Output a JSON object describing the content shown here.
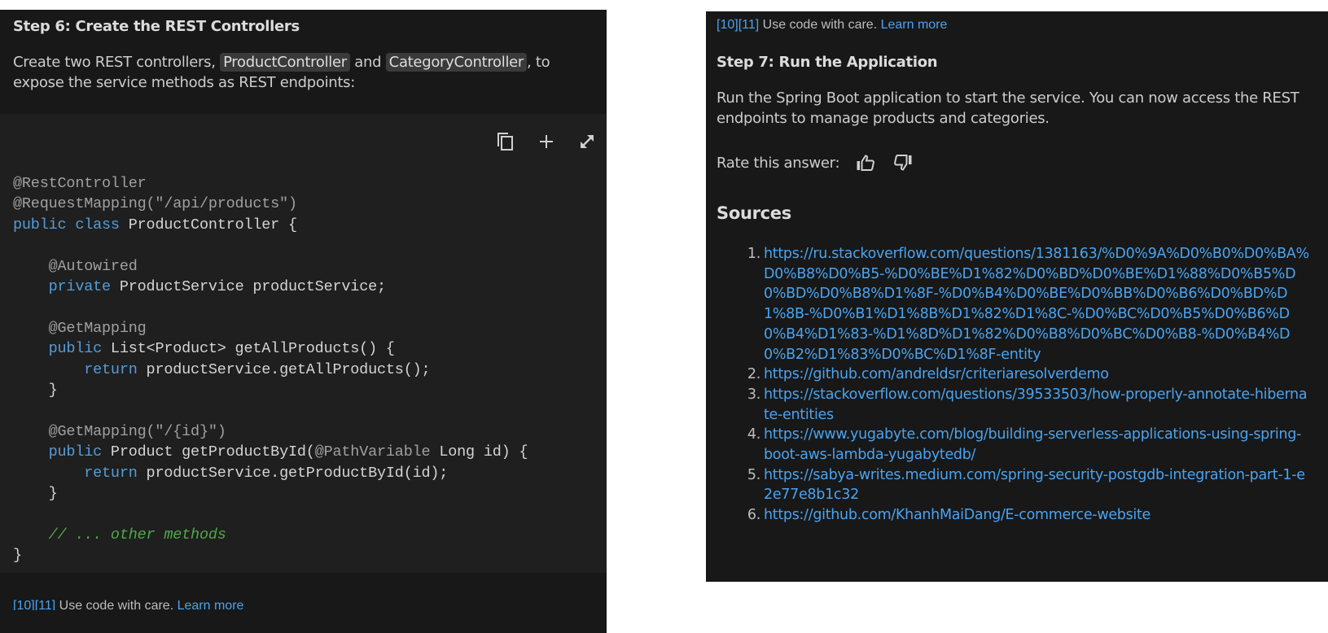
{
  "left": {
    "step_title": "Step 6: Create the REST Controllers",
    "intro": {
      "before": "Create two REST controllers, ",
      "chip1": "ProductController",
      "middle": " and ",
      "chip2": "CategoryController",
      "after": ", to expose the service methods as REST endpoints:"
    },
    "code_toolbar": {
      "copy_icon": "copy-icon",
      "add_icon": "plus-icon",
      "expand_icon": "expand-icon"
    },
    "code_lines": [
      [
        {
          "t": "anno",
          "v": "@RestController"
        }
      ],
      [
        {
          "t": "anno",
          "v": "@RequestMapping(\"/api/products\")"
        }
      ],
      [
        {
          "t": "kw",
          "v": "public"
        },
        {
          "t": "pl",
          "v": " "
        },
        {
          "t": "kw",
          "v": "class"
        },
        {
          "t": "pl",
          "v": " ProductController {"
        }
      ],
      [],
      [
        {
          "t": "pl",
          "v": "    "
        },
        {
          "t": "anno",
          "v": "@Autowired"
        }
      ],
      [
        {
          "t": "pl",
          "v": "    "
        },
        {
          "t": "kw",
          "v": "private"
        },
        {
          "t": "pl",
          "v": " ProductService productService;"
        }
      ],
      [],
      [
        {
          "t": "pl",
          "v": "    "
        },
        {
          "t": "anno",
          "v": "@GetMapping"
        }
      ],
      [
        {
          "t": "pl",
          "v": "    "
        },
        {
          "t": "kw",
          "v": "public"
        },
        {
          "t": "pl",
          "v": " List<Product> getAllProducts() {"
        }
      ],
      [
        {
          "t": "pl",
          "v": "        "
        },
        {
          "t": "kw",
          "v": "return"
        },
        {
          "t": "pl",
          "v": " productService.getAllProducts();"
        }
      ],
      [
        {
          "t": "pl",
          "v": "    }"
        }
      ],
      [],
      [
        {
          "t": "pl",
          "v": "    "
        },
        {
          "t": "anno",
          "v": "@GetMapping(\"/{id}\")"
        }
      ],
      [
        {
          "t": "pl",
          "v": "    "
        },
        {
          "t": "kw",
          "v": "public"
        },
        {
          "t": "pl",
          "v": " Product getProductById("
        },
        {
          "t": "anno",
          "v": "@PathVariable"
        },
        {
          "t": "pl",
          "v": " Long id) {"
        }
      ],
      [
        {
          "t": "pl",
          "v": "        "
        },
        {
          "t": "kw",
          "v": "return"
        },
        {
          "t": "pl",
          "v": " productService.getProductById(id);"
        }
      ],
      [
        {
          "t": "pl",
          "v": "    }"
        }
      ],
      [],
      [
        {
          "t": "pl",
          "v": "    "
        },
        {
          "t": "com",
          "v": "// ... other methods"
        }
      ],
      [
        {
          "t": "pl",
          "v": "}"
        }
      ]
    ],
    "care": {
      "refs": "[10][11]",
      "text": " Use code with care. ",
      "link": "Learn more"
    }
  },
  "right": {
    "care": {
      "refs": "[10][11]",
      "text": " Use code with care. ",
      "link": "Learn more"
    },
    "step_title": "Step 7: Run the Application",
    "body": "Run the Spring Boot application to start the service. You can now access the REST endpoints to manage products and categories.",
    "rate_label": "Rate this answer:",
    "sources_title": "Sources",
    "sources": [
      {
        "num": "1.",
        "url": "https://ru.stackoverflow.com/questions/1381163/%D0%9A%D0%B0%D0%BA%D0%B8%D0%B5-%D0%BE%D1%82%D0%BD%D0%BE%D1%88%D0%B5%D0%BD%D0%B8%D1%8F-%D0%B4%D0%BE%D0%BB%D0%B6%D0%BD%D1%8B-%D0%B1%D1%8B%D1%82%D1%8C-%D0%BC%D0%B5%D0%B6%D0%B4%D1%83-%D1%8D%D1%82%D0%B8%D0%BC%D0%B8-%D0%B4%D0%B2%D1%83%D0%BC%D1%8F-entity"
      },
      {
        "num": "2.",
        "url": "https://github.com/andreldsr/criteriaresolverdemo"
      },
      {
        "num": "3.",
        "url": "https://stackoverflow.com/questions/39533503/how-properly-annotate-hibernate-entities"
      },
      {
        "num": "4.",
        "url": "https://www.yugabyte.com/blog/building-serverless-applications-using-spring-boot-aws-lambda-yugabytedb/"
      },
      {
        "num": "5.",
        "url": "https://sabya-writes.medium.com/spring-security-postgdb-integration-part-1-e2e77e8b1c32"
      },
      {
        "num": "6.",
        "url": "https://github.com/KhanhMaiDang/E-commerce-website"
      }
    ]
  },
  "colors": {
    "panel_bg": "#181818",
    "code_bg": "#1f1f1f",
    "link": "#4aa3f0",
    "keyword": "#569cd6",
    "annotation": "#a0a0a0",
    "comment": "#4fa84a"
  }
}
